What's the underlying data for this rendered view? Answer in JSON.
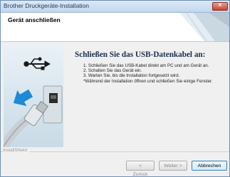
{
  "window": {
    "title": "Brother Druckgeräte-Installation",
    "close_glyph": "×"
  },
  "header": {
    "title": "Gerät anschließen"
  },
  "main": {
    "heading": "Schließen Sie das USB-Datenkabel an:",
    "steps": [
      "1. Schließen Sie das USB-Kabel direkt am PC und am Gerät an.",
      "2. Schalten Sie das Gerät ein.",
      "3. Warten Sie, bis die Installation fortgesetzt wird."
    ],
    "note": "*Während der Installation öffnen und schließen Sie einige Fenster."
  },
  "footer": {
    "brand": "InstallShield",
    "back_label": "< Zurück",
    "next_label": "Weiter >",
    "cancel_label": "Abbrechen"
  },
  "colors": {
    "accent": "#3c7fb1",
    "heading": "#1a2d4f",
    "arrow": "#1f8ad6"
  }
}
